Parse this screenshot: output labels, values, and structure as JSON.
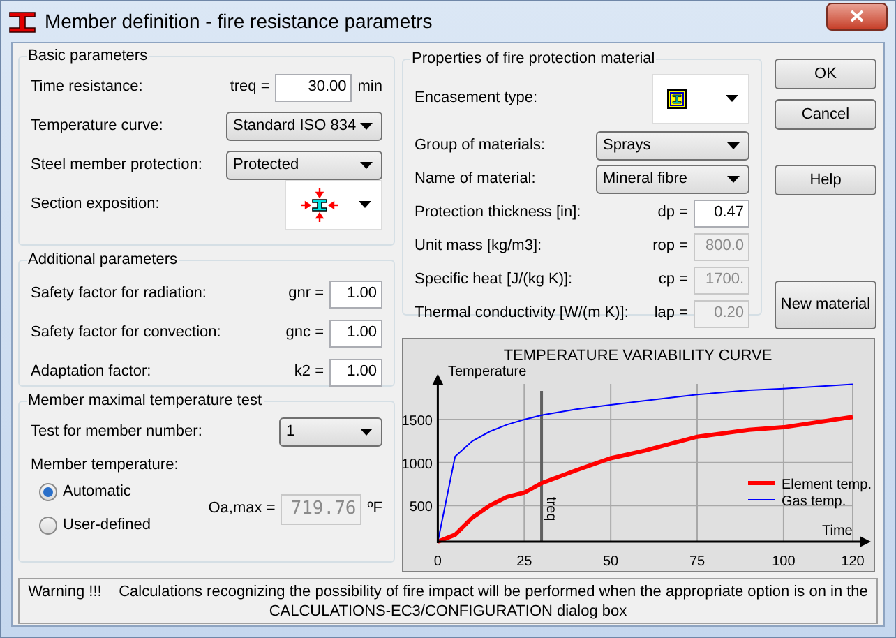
{
  "window": {
    "title": "Member definition  - fire resistance parametrs"
  },
  "basic_parameters": {
    "title": "Basic parameters",
    "rows": [
      {
        "kind": "input",
        "label": "Time resistance:",
        "symbol": "treq =",
        "value": "30.00",
        "unit": "min",
        "disabled": false
      },
      {
        "kind": "select",
        "label": "Temperature curve:",
        "value": "Standard ISO 834"
      },
      {
        "kind": "select",
        "label": "Steel member protection:",
        "value": "Protected"
      },
      {
        "kind": "icon_select",
        "label": "Section exposition:"
      }
    ]
  },
  "additional_parameters": {
    "title": "Additional parameters",
    "rows": [
      {
        "kind": "input",
        "label": "Safety factor for radiation:",
        "symbol": "gnr =",
        "value": "1.00",
        "disabled": false
      },
      {
        "kind": "input",
        "label": "Safety factor for convection:",
        "symbol": "gnc =",
        "value": "1.00",
        "disabled": false
      },
      {
        "kind": "input",
        "label": "Adaptation factor:",
        "symbol": "k2 =",
        "value": "1.00",
        "disabled": false
      }
    ]
  },
  "temperature_test": {
    "title": "Member maximal temperature test",
    "member_label": "Test for member number:",
    "member_value": "1",
    "temperature_label": "Member temperature:",
    "options": [
      {
        "label": "Automatic",
        "selected": true
      },
      {
        "label": "User-defined",
        "selected": false
      }
    ],
    "result": {
      "symbol": "Oa,max =",
      "value": "719.76",
      "unit": "ºF",
      "disabled": true
    }
  },
  "material": {
    "title": "Properties of fire protection material",
    "rows": [
      {
        "kind": "icon_select",
        "label": "Encasement type:"
      },
      {
        "kind": "select",
        "label": "Group of materials:",
        "value": "Sprays"
      },
      {
        "kind": "select",
        "label": "Name of material:",
        "value": "Mineral fibre"
      },
      {
        "kind": "input",
        "label": "Protection thickness [in]:",
        "symbol": "dp =",
        "value": "0.47",
        "disabled": false
      },
      {
        "kind": "input",
        "label": "Unit mass [kg/m3]:",
        "symbol": "rop =",
        "value": "800.0",
        "disabled": true
      },
      {
        "kind": "input",
        "label": "Specific heat  [J/(kg K)]:",
        "symbol": "cp =",
        "value": "1700.",
        "disabled": true
      },
      {
        "kind": "input",
        "label": "Thermal conductivity  [W/(m K)]:",
        "symbol": "lap =",
        "value": "0.20",
        "disabled": true
      }
    ]
  },
  "buttons": [
    {
      "label": "OK",
      "kind": "normal"
    },
    {
      "label": "Cancel",
      "kind": "normal"
    },
    {
      "label": "Help",
      "kind": "spaced"
    },
    {
      "label": "New material",
      "kind": "tall"
    }
  ],
  "chart_data": {
    "type": "line",
    "title": "TEMPERATURE VARIABILITY CURVE",
    "xlabel": "Time",
    "ylabel": "Temperature",
    "x": [
      0,
      5,
      10,
      15,
      20,
      25,
      30,
      40,
      50,
      60,
      75,
      90,
      100,
      120
    ],
    "series": [
      {
        "name": "Element temp.",
        "color": "#ff0000",
        "values": [
          80,
          160,
          360,
          500,
          600,
          650,
          760,
          910,
          1050,
          1140,
          1300,
          1380,
          1410,
          1530
        ]
      },
      {
        "name": "Gas temp.",
        "color": "#0000ff",
        "values": [
          80,
          1070,
          1250,
          1360,
          1440,
          1500,
          1550,
          1620,
          1670,
          1720,
          1790,
          1840,
          1860,
          1910
        ]
      }
    ],
    "xlim": [
      0,
      120
    ],
    "ylim": [
      80,
      2000
    ],
    "xticks": [
      0,
      25,
      50,
      75,
      100,
      120
    ],
    "yticks": [
      500,
      1000,
      1500
    ],
    "grid": true,
    "legend": "lower right",
    "ref_lines": [
      {
        "axis": "x",
        "value": 30,
        "label": "treq"
      }
    ]
  },
  "warning": {
    "label": "Warning !!!",
    "text": "Calculations recognizing the possibility of fire impact will be performed when the appropriate option is on in the CALCULATIONS-EC3/CONFIGURATION dialog box"
  }
}
